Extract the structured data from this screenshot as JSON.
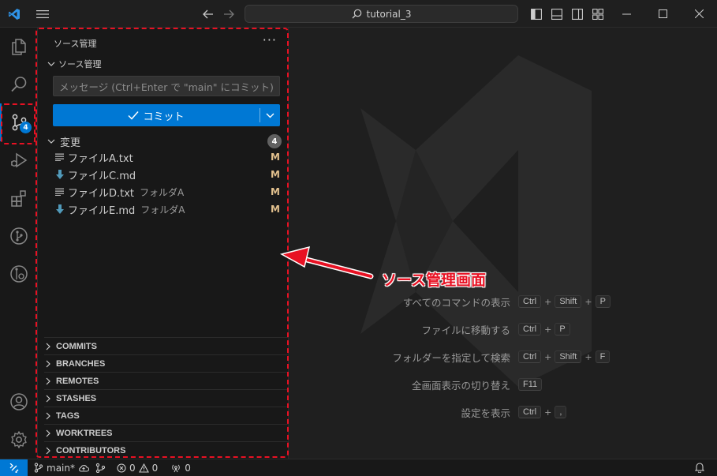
{
  "titlebar": {
    "search_text": "tutorial_3"
  },
  "activitybar": {
    "scm_badge": "4"
  },
  "sidebar": {
    "title": "ソース管理",
    "more": "···",
    "section_label": "ソース管理",
    "message_placeholder": "メッセージ (Ctrl+Enter で \"main\" にコミット)",
    "commit_label": "コミット",
    "changes_label": "変更",
    "changes_count": "4",
    "files": [
      {
        "name": "ファイルA.txt",
        "folder": "",
        "status": "M",
        "icon": "text-file-icon"
      },
      {
        "name": "ファイルC.md",
        "folder": "",
        "status": "M",
        "icon": "markdown-file-icon"
      },
      {
        "name": "ファイルD.txt",
        "folder": "フォルダA",
        "status": "M",
        "icon": "text-file-icon"
      },
      {
        "name": "ファイルE.md",
        "folder": "フォルダA",
        "status": "M",
        "icon": "markdown-file-icon"
      }
    ],
    "collapsed_sections": [
      "COMMITS",
      "BRANCHES",
      "REMOTES",
      "STASHES",
      "TAGS",
      "WORKTREES",
      "CONTRIBUTORS"
    ]
  },
  "callout": {
    "text": "ソース管理画面",
    "color": "#e81123"
  },
  "shortcuts": [
    {
      "label": "すべてのコマンドの表示",
      "keys": [
        "Ctrl",
        "Shift",
        "P"
      ]
    },
    {
      "label": "ファイルに移動する",
      "keys": [
        "Ctrl",
        "P"
      ]
    },
    {
      "label": "フォルダーを指定して検索",
      "keys": [
        "Ctrl",
        "Shift",
        "F"
      ]
    },
    {
      "label": "全画面表示の切り替え",
      "keys": [
        "F11"
      ]
    },
    {
      "label": "設定を表示",
      "keys": [
        "Ctrl",
        ","
      ]
    }
  ],
  "statusbar": {
    "branch": "main*",
    "errors": "0",
    "warnings": "0",
    "ports": "0"
  },
  "colors": {
    "accent": "#0078d4",
    "modified": "#e2c08d",
    "highlight": "#e81123"
  }
}
